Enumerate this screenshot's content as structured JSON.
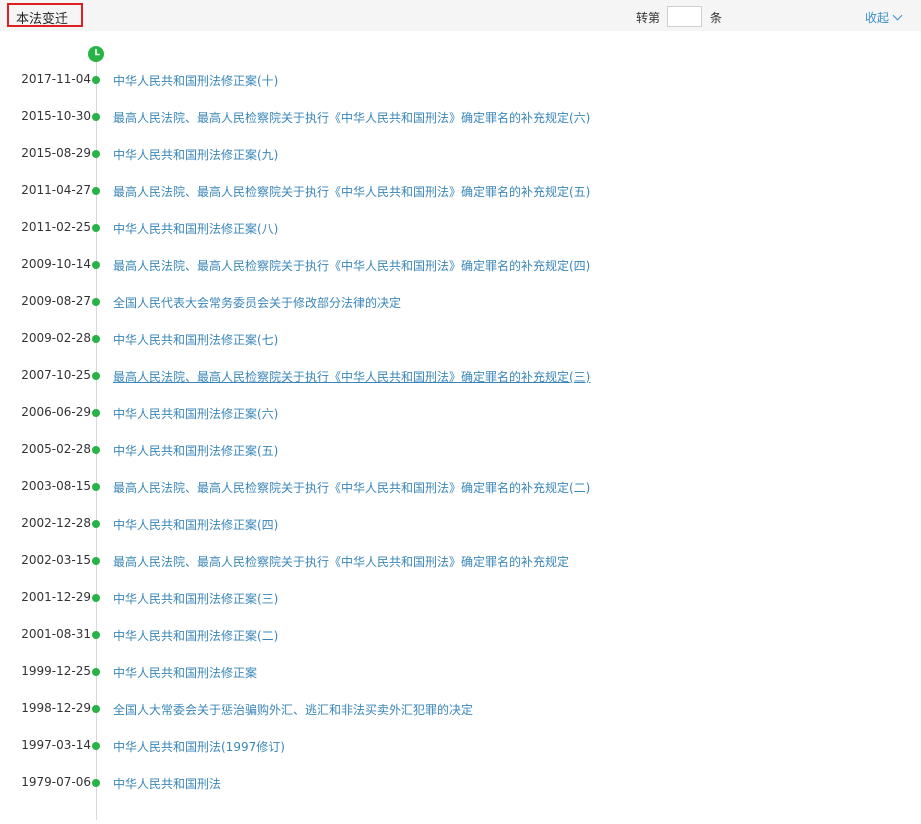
{
  "header": {
    "title": "本法变迁",
    "jump_prefix": "转第",
    "jump_value": "",
    "jump_suffix": "条",
    "collapse_label": "收起"
  },
  "timeline": [
    {
      "date": "2017-11-04",
      "title": "中华人民共和国刑法修正案(十)"
    },
    {
      "date": "2015-10-30",
      "title": "最高人民法院、最高人民检察院关于执行《中华人民共和国刑法》确定罪名的补充规定(六)"
    },
    {
      "date": "2015-08-29",
      "title": "中华人民共和国刑法修正案(九)"
    },
    {
      "date": "2011-04-27",
      "title": "最高人民法院、最高人民检察院关于执行《中华人民共和国刑法》确定罪名的补充规定(五)"
    },
    {
      "date": "2011-02-25",
      "title": "中华人民共和国刑法修正案(八)"
    },
    {
      "date": "2009-10-14",
      "title": "最高人民法院、最高人民检察院关于执行《中华人民共和国刑法》确定罪名的补充规定(四)"
    },
    {
      "date": "2009-08-27",
      "title": "全国人民代表大会常务委员会关于修改部分法律的决定"
    },
    {
      "date": "2009-02-28",
      "title": "中华人民共和国刑法修正案(七)"
    },
    {
      "date": "2007-10-25",
      "title": "最高人民法院、最高人民检察院关于执行《中华人民共和国刑法》确定罪名的补充规定(三)"
    },
    {
      "date": "2006-06-29",
      "title": "中华人民共和国刑法修正案(六)"
    },
    {
      "date": "2005-02-28",
      "title": "中华人民共和国刑法修正案(五)"
    },
    {
      "date": "2003-08-15",
      "title": "最高人民法院、最高人民检察院关于执行《中华人民共和国刑法》确定罪名的补充规定(二)"
    },
    {
      "date": "2002-12-28",
      "title": "中华人民共和国刑法修正案(四)"
    },
    {
      "date": "2002-03-15",
      "title": "最高人民法院、最高人民检察院关于执行《中华人民共和国刑法》确定罪名的补充规定"
    },
    {
      "date": "2001-12-29",
      "title": "中华人民共和国刑法修正案(三)"
    },
    {
      "date": "2001-08-31",
      "title": "中华人民共和国刑法修正案(二)"
    },
    {
      "date": "1999-12-25",
      "title": "中华人民共和国刑法修正案"
    },
    {
      "date": "1998-12-29",
      "title": "全国人大常委会关于惩治骗购外汇、逃汇和非法买卖外汇犯罪的决定"
    },
    {
      "date": "1997-03-14",
      "title": "中华人民共和国刑法(1997修订)"
    },
    {
      "date": "1979-07-06",
      "title": "中华人民共和国刑法"
    }
  ],
  "colors": {
    "accent_green": "#27b346",
    "link_blue": "#3a86b8",
    "title_border": "#e02020"
  }
}
